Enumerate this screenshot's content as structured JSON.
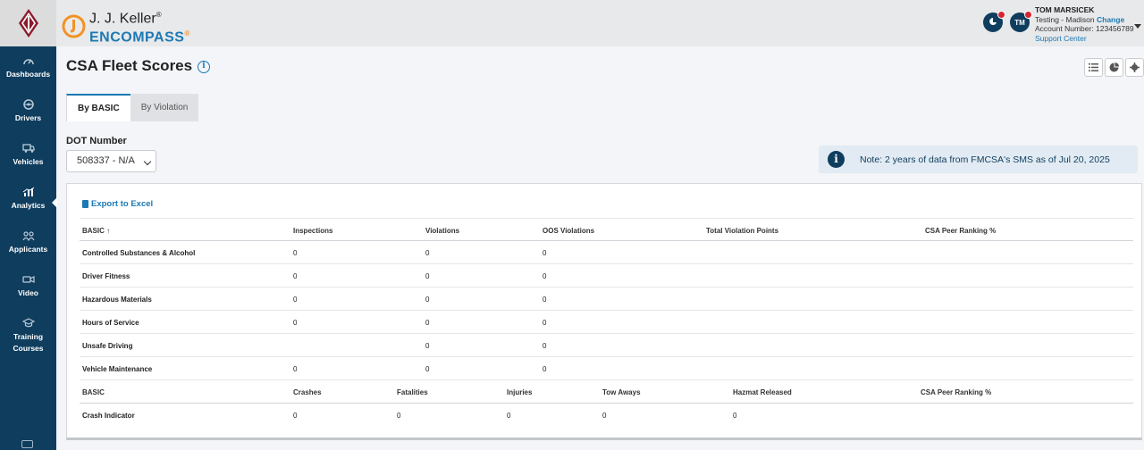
{
  "brand": {
    "name": "J. J. Keller",
    "name_mark": "®",
    "product": "ENCOMPASS",
    "product_mark": "®"
  },
  "sidebar": {
    "items": [
      {
        "label": "Dashboards",
        "icon": "gauge-icon"
      },
      {
        "label": "Drivers",
        "icon": "steering-wheel-icon"
      },
      {
        "label": "Vehicles",
        "icon": "truck-icon"
      },
      {
        "label": "Analytics",
        "icon": "chart-icon",
        "active": true
      },
      {
        "label": "Applicants",
        "icon": "users-icon"
      },
      {
        "label": "Video",
        "icon": "video-icon"
      },
      {
        "label": "Training",
        "label2": "Courses",
        "icon": "graduation-cap-icon"
      }
    ]
  },
  "header": {
    "notifications_icon": "notification-icon",
    "avatar_initials": "TM",
    "user": {
      "name": "TOM MARSICEK",
      "location": "Testing - Madison",
      "change_label": "Change",
      "account": "Account Number: 123456789",
      "support": "Support Center"
    }
  },
  "page": {
    "title": "CSA Fleet Scores",
    "tabs": [
      "By BASIC",
      "By Violation"
    ],
    "dot_label": "DOT Number",
    "dot_value": "508337 - N/A",
    "note": "Note: 2 years of data from FMCSA's SMS as of Jul 20, 2025",
    "export_label": "Export to Excel"
  },
  "table1": {
    "headers": [
      "BASIC ↑",
      "Inspections",
      "Violations",
      "OOS Violations",
      "Total Violation Points",
      "CSA Peer Ranking %"
    ],
    "rows": [
      [
        "Controlled Substances & Alcohol",
        "0",
        "0",
        "0",
        "",
        ""
      ],
      [
        "Driver Fitness",
        "0",
        "0",
        "0",
        "",
        ""
      ],
      [
        "Hazardous Materials",
        "0",
        "0",
        "0",
        "",
        ""
      ],
      [
        "Hours of Service",
        "0",
        "0",
        "0",
        "",
        ""
      ],
      [
        "Unsafe Driving",
        "",
        "0",
        "0",
        "",
        ""
      ],
      [
        "Vehicle Maintenance",
        "0",
        "0",
        "0",
        "",
        ""
      ]
    ]
  },
  "table2": {
    "headers": [
      "BASIC",
      "Crashes",
      "Fatalities",
      "Injuries",
      "Tow Aways",
      "Hazmat Released",
      "CSA Peer Ranking %"
    ],
    "rows": [
      [
        "Crash Indicator",
        "0",
        "0",
        "0",
        "0",
        "0",
        ""
      ]
    ]
  },
  "colors": {
    "sidebar": "#0f3d5e",
    "accent": "#1c79b3",
    "alert": "#d9232e",
    "orange": "#f39223"
  }
}
